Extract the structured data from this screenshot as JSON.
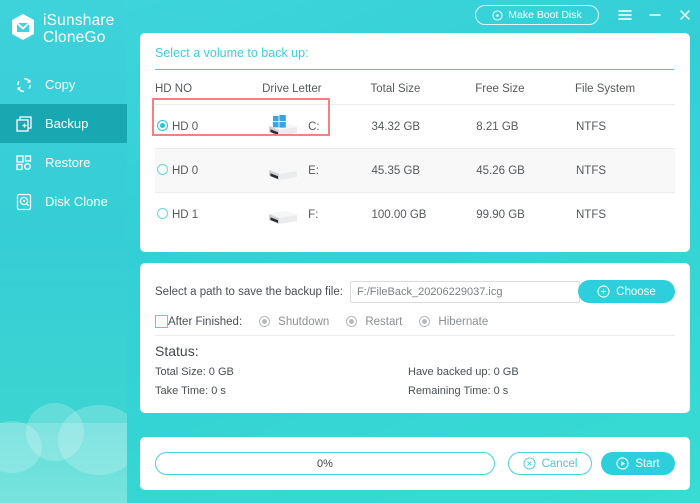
{
  "brand": {
    "line1": "iSunshare",
    "line2": "CloneGo",
    "logo_icon": "shield-logo-icon"
  },
  "sidebar": {
    "items": [
      {
        "label": "Copy",
        "icon": "copy-icon",
        "active": false
      },
      {
        "label": "Backup",
        "icon": "backup-icon",
        "active": true
      },
      {
        "label": "Restore",
        "icon": "restore-icon",
        "active": false
      },
      {
        "label": "Disk Clone",
        "icon": "disk-clone-icon",
        "active": false
      }
    ]
  },
  "titlebar": {
    "boot_disk_label": "Make Boot Disk",
    "boot_disk_icon": "disc-icon",
    "menu_icon": "hamburger-menu-icon",
    "minimize_icon": "minimize-icon",
    "close_icon": "close-icon"
  },
  "volumes": {
    "title": "Select a volume to back up:",
    "columns": [
      "HD NO",
      "Drive Letter",
      "Total Size",
      "Free Size",
      "File System"
    ],
    "rows": [
      {
        "hd_no": "HD 0",
        "drive_letter": "C:",
        "total_size": "34.32 GB",
        "free_size": "8.21 GB",
        "file_system": "NTFS",
        "selected": true,
        "system_drive": true
      },
      {
        "hd_no": "HD 0",
        "drive_letter": "E:",
        "total_size": "45.35 GB",
        "free_size": "45.26 GB",
        "file_system": "NTFS",
        "selected": false,
        "system_drive": false
      },
      {
        "hd_no": "HD 1",
        "drive_letter": "F:",
        "total_size": "100.00 GB",
        "free_size": "99.90 GB",
        "file_system": "NTFS",
        "selected": false,
        "system_drive": false
      }
    ],
    "highlight_color": "#f2827f"
  },
  "path": {
    "label": "Select a path to save the backup file:",
    "value": "F:/FileBack_20206229037.icg",
    "placeholder": "F:/FileBack_20206229037.icg",
    "choose_label": "Choose",
    "choose_icon": "plus-circle-icon",
    "after_finished_label": "After Finished:",
    "after_finished_checked": false,
    "options": [
      {
        "label": "Shutdown",
        "selected": false
      },
      {
        "label": "Restart",
        "selected": false
      },
      {
        "label": "Hibernate",
        "selected": false
      }
    ]
  },
  "status": {
    "title": "Status:",
    "total_size": "Total Size: 0 GB",
    "have_backed_up": "Have backed up: 0 GB",
    "take_time": "Take Time: 0 s",
    "remaining_time": "Remaining Time: 0 s"
  },
  "actions": {
    "progress_text": "0%",
    "progress_percent": 0,
    "cancel_label": "Cancel",
    "cancel_icon": "close-circle-icon",
    "start_label": "Start",
    "start_icon": "play-circle-icon"
  },
  "theme": {
    "accent": "#2ecfdc",
    "sidebar_active": "#19a8b2",
    "title_text": "#3ccfd8"
  }
}
